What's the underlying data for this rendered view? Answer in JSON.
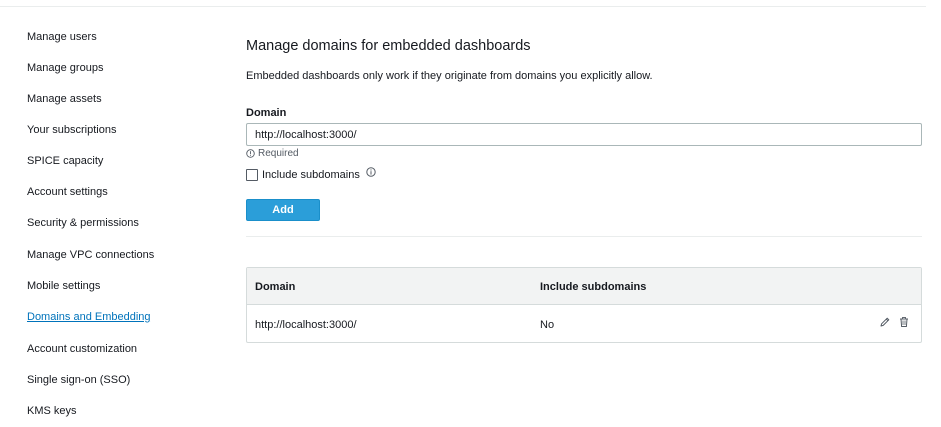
{
  "sidebar": {
    "items": [
      {
        "label": "Manage users",
        "active": false
      },
      {
        "label": "Manage groups",
        "active": false
      },
      {
        "label": "Manage assets",
        "active": false
      },
      {
        "label": "Your subscriptions",
        "active": false
      },
      {
        "label": "SPICE capacity",
        "active": false
      },
      {
        "label": "Account settings",
        "active": false
      },
      {
        "label": "Security & permissions",
        "active": false
      },
      {
        "label": "Manage VPC connections",
        "active": false
      },
      {
        "label": "Mobile settings",
        "active": false
      },
      {
        "label": "Domains and Embedding",
        "active": true
      },
      {
        "label": "Account customization",
        "active": false
      },
      {
        "label": "Single sign-on (SSO)",
        "active": false
      },
      {
        "label": "KMS keys",
        "active": false
      }
    ]
  },
  "main": {
    "title": "Manage domains for embedded dashboards",
    "description": "Embedded dashboards only work if they originate from domains you explicitly allow.",
    "form": {
      "domain_label": "Domain",
      "domain_value": "http://localhost:3000/",
      "required_hint": "Required",
      "include_subdomains_label": "Include subdomains",
      "include_subdomains_checked": false,
      "add_button_label": "Add"
    },
    "table": {
      "headers": {
        "domain": "Domain",
        "include_subdomains": "Include subdomains"
      },
      "rows": [
        {
          "domain": "http://localhost:3000/",
          "include_subdomains": "No"
        }
      ]
    }
  },
  "icons": {
    "hint": "info-circle-icon",
    "info": "info-circle-icon",
    "edit": "pencil-icon",
    "delete": "trash-icon"
  },
  "colors": {
    "accent": "#0073bb",
    "button": "#2b9ed9",
    "text": "#16191f",
    "header_bg": "#f2f3f3",
    "border": "#d5dbdb"
  }
}
